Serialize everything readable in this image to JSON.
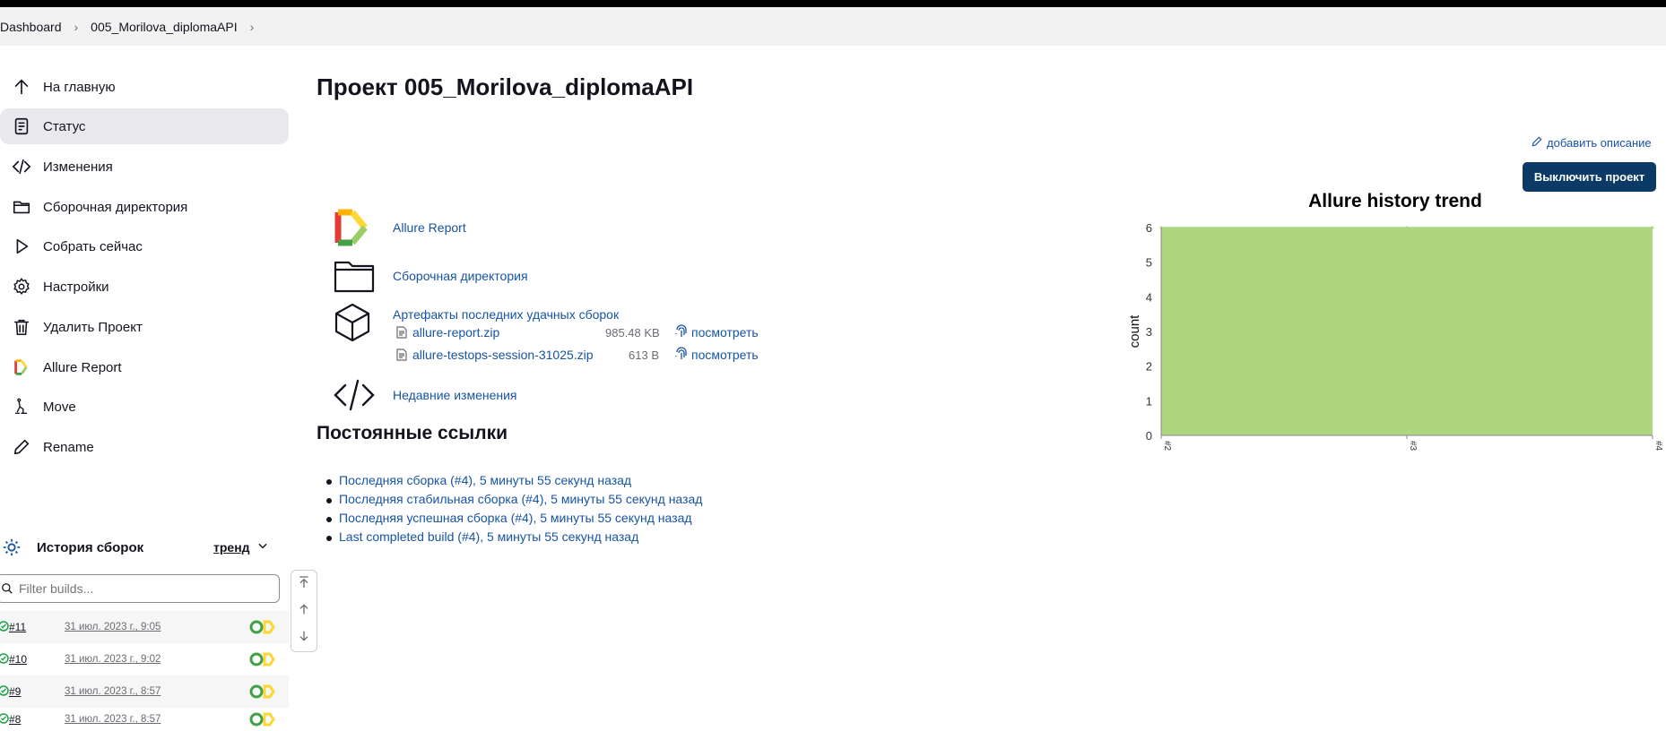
{
  "breadcrumbs": [
    "Dashboard",
    "005_Morilova_diplomaAPI"
  ],
  "sidebar": {
    "items": [
      {
        "label": "На главную",
        "icon": "arrow-up-icon"
      },
      {
        "label": "Статус",
        "icon": "document-icon"
      },
      {
        "label": "Изменения",
        "icon": "code-icon"
      },
      {
        "label": "Сборочная директория",
        "icon": "folder-icon"
      },
      {
        "label": "Собрать сейчас",
        "icon": "play-icon"
      },
      {
        "label": "Настройки",
        "icon": "gear-icon"
      },
      {
        "label": "Удалить Проект",
        "icon": "trash-icon"
      },
      {
        "label": "Allure Report",
        "icon": "allure-logo-icon"
      },
      {
        "label": "Move",
        "icon": "move-icon"
      },
      {
        "label": "Rename",
        "icon": "pencil-icon"
      }
    ],
    "active_item": "Статус"
  },
  "history": {
    "title": "История сборок",
    "trend_label": "тренд",
    "filter_placeholder": "Filter builds...",
    "builds": [
      {
        "number": "#11",
        "date": "31 июл. 2023 г., 9:05"
      },
      {
        "number": "#10",
        "date": "31 июл. 2023 г., 9:02"
      },
      {
        "number": "#9",
        "date": "31 июл. 2023 г., 8:57"
      },
      {
        "number": "#8",
        "date": "31 июл. 2023 г., 8:57"
      }
    ]
  },
  "main": {
    "title": "Проект 005_Morilova_diplomaAPI",
    "add_description": "добавить описание",
    "disable_button": "Выключить проект",
    "links": {
      "allure_report": "Allure Report",
      "workspace": "Сборочная директория",
      "recent_changes": "Недавние изменения"
    },
    "artifacts": {
      "title": "Артефакты последних удачных сборок",
      "files": [
        {
          "name": "allure-report.zip",
          "size": "985.48 KB",
          "view": "посмотреть"
        },
        {
          "name": "allure-testops-session-31025.zip",
          "size": "613 B",
          "view": "посмотреть"
        }
      ]
    },
    "permalinks": {
      "title": "Постоянные ссылки",
      "items": [
        "Последняя сборка (#4), 5 минуты 55 секунд назад",
        "Последняя стабильная сборка (#4), 5 минуты 55 секунд назад",
        "Последняя успешная сборка (#4), 5 минуты 55 секунд назад",
        "Last completed build (#4), 5 минуты 55 секунд назад"
      ]
    }
  },
  "chart_data": {
    "type": "area",
    "title": "Allure history trend",
    "ylabel": "count",
    "xlabel": "",
    "categories": [
      "#2",
      "#3",
      "#4"
    ],
    "series": [
      {
        "values": [
          6,
          6,
          6
        ],
        "color": "#aed580"
      }
    ],
    "ylim": [
      0,
      6
    ],
    "yticks": [
      0,
      1,
      2,
      3,
      4,
      5,
      6
    ],
    "grid": true
  },
  "colors": {
    "accent": "#1654a4",
    "button": "#0b3a66",
    "chart_fill": "#aed580"
  }
}
